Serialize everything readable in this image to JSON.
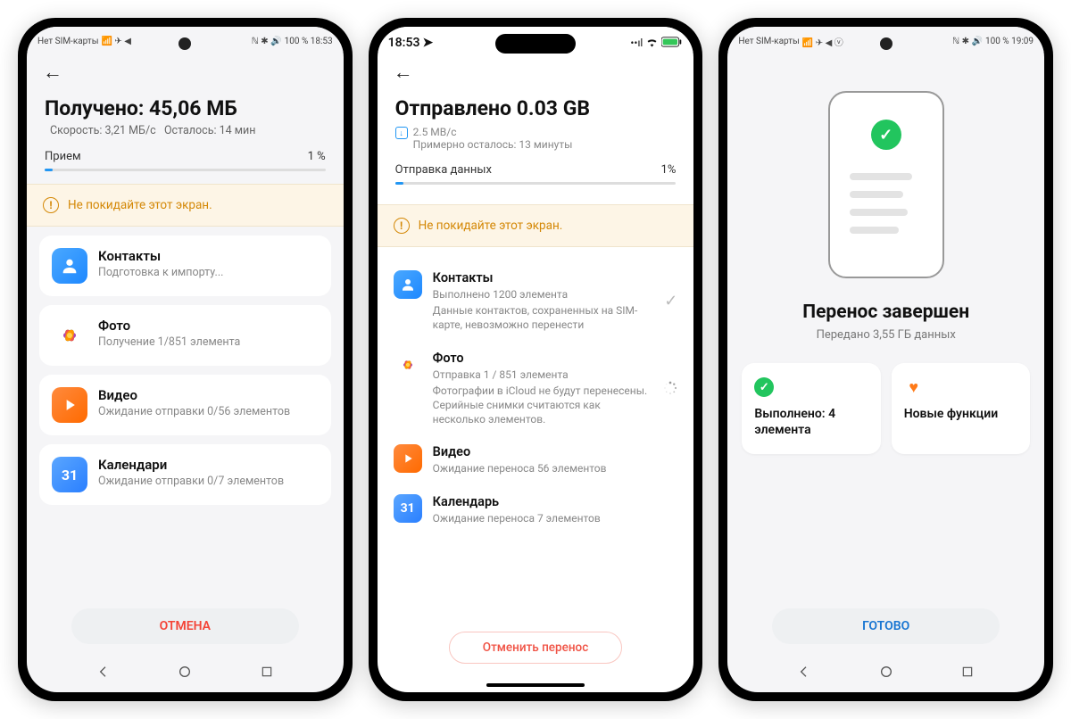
{
  "phone1": {
    "status_left": "Нет SIM-карты",
    "status_right": "100 %  18:53",
    "title": "Получено: 45,06 МБ",
    "speed": "Скорость: 3,21 МБ/с",
    "remaining": "Осталось: 14 мин",
    "progress_label": "Прием",
    "progress_pct": "1 %",
    "banner": "Не покидайте этот экран.",
    "items": [
      {
        "title": "Контакты",
        "desc": "Подготовка к импорту..."
      },
      {
        "title": "Фото",
        "desc": "Получение 1/851 элемента"
      },
      {
        "title": "Видео",
        "desc": "Ожидание отправки 0/56 элементов"
      },
      {
        "title": "Календари",
        "desc": "Ожидание отправки 0/7 элементов"
      }
    ],
    "cal_day": "31",
    "cancel": "ОТМЕНА"
  },
  "phone2": {
    "time": "18:53",
    "title": "Отправлено 0.03 GB",
    "speed": "2.5 MB/c",
    "remaining": "Примерно осталось: 13 минуты",
    "progress_label": "Отправка данных",
    "progress_pct": "1%",
    "banner": "Не покидайте этот экран.",
    "items": [
      {
        "title": "Контакты",
        "sub": "Выполнено 1200 элемента",
        "note": "Данные контактов, сохраненных на SIM-карте, невозможно перенести"
      },
      {
        "title": "Фото",
        "sub": "Отправка 1 / 851 элемента",
        "note": "Фотографии в iCloud не будут перенесены. Серийные снимки считаются как несколько элементов."
      },
      {
        "title": "Видео",
        "sub": "Ожидание переноса 56 элементов",
        "note": ""
      },
      {
        "title": "Календарь",
        "sub": "Ожидание переноса 7 элементов",
        "note": ""
      }
    ],
    "cal_day": "31",
    "cancel": "Отменить перенос"
  },
  "phone3": {
    "status_left": "Нет SIM-карты",
    "status_right": "100 %  19:09",
    "title": "Перенос завершен",
    "sub": "Передано 3,55 ГБ данных",
    "tile1": "Выполнено: 4 элемента",
    "tile2": "Новые функции",
    "done": "ГОТОВО"
  }
}
